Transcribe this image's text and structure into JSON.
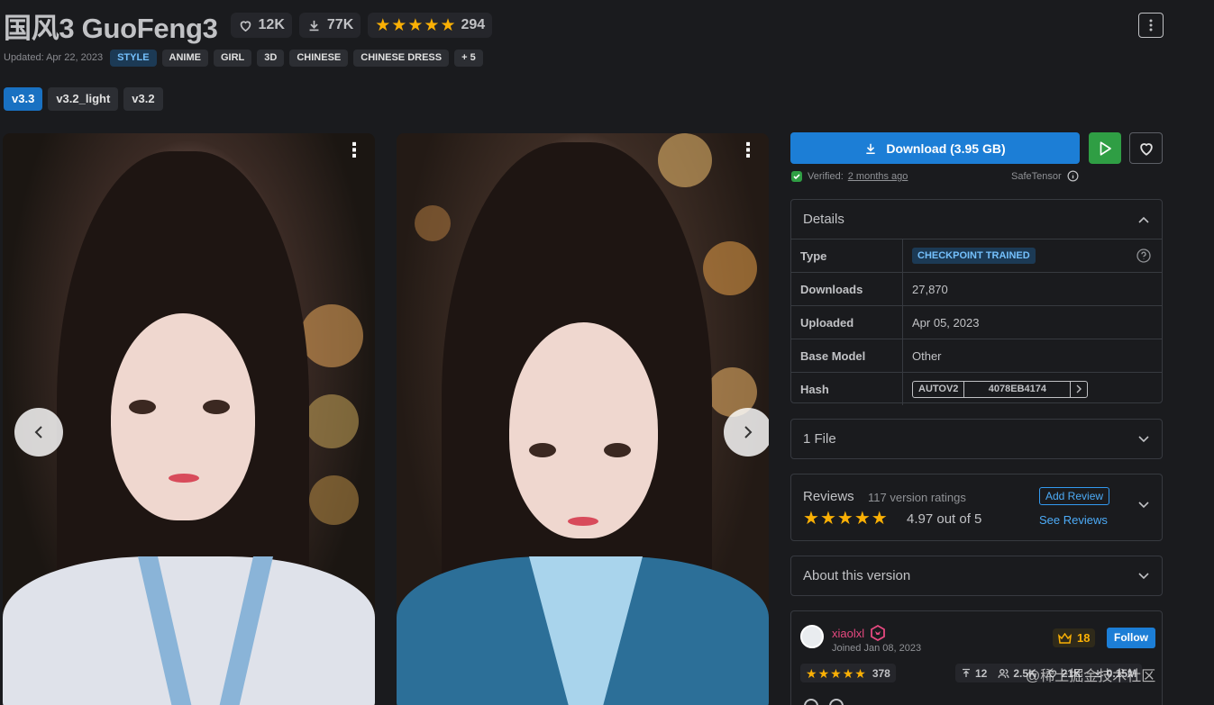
{
  "header": {
    "title": "国风3 GuoFeng3",
    "likes": "12K",
    "downloads": "77K",
    "rating_count": "294",
    "updated": "Updated: Apr 22, 2023",
    "tags": [
      "STYLE",
      "ANIME",
      "GIRL",
      "3D",
      "CHINESE",
      "CHINESE DRESS",
      "+ 5"
    ]
  },
  "versions": [
    "v3.3",
    "v3.2_light",
    "v3.2"
  ],
  "actions": {
    "download_label": "Download (3.95 GB)",
    "verified_label": "Verified:",
    "verified_when": "2 months ago",
    "safetensor": "SafeTensor"
  },
  "details": {
    "title": "Details",
    "rows": [
      {
        "label": "Type",
        "value": "CHECKPOINT TRAINED"
      },
      {
        "label": "Downloads",
        "value": "27,870"
      },
      {
        "label": "Uploaded",
        "value": "Apr 05, 2023"
      },
      {
        "label": "Base Model",
        "value": "Other"
      },
      {
        "label": "Hash",
        "value": ""
      }
    ],
    "hash_type": "AUTOV2",
    "hash_value": "4078EB4174"
  },
  "files": {
    "label": "1 File"
  },
  "reviews": {
    "title": "Reviews",
    "count": "117 version ratings",
    "score": "4.97 out of 5",
    "add_review": "Add Review",
    "see_reviews": "See Reviews"
  },
  "about": {
    "label": "About this version"
  },
  "creator": {
    "name": "xiaolxl",
    "joined": "Joined Jan 08, 2023",
    "crown_count": "18",
    "follow": "Follow",
    "rating": "378",
    "uploads": "12",
    "followers": "2.5K",
    "favorites": "21K",
    "downloads": "0.15M"
  },
  "watermark": "@稀土掘金技术社区",
  "colors": {
    "accent": "#1c7ed6",
    "run": "#2f9e44",
    "star": "#fab005",
    "creator_name": "#e64980"
  }
}
